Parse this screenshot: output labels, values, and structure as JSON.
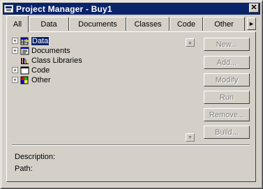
{
  "window": {
    "title": "Project Manager - Buy1",
    "close_glyph": "✕"
  },
  "tabs": [
    {
      "label": "All",
      "active": true
    },
    {
      "label": "Data",
      "active": false
    },
    {
      "label": "Documents",
      "active": false
    },
    {
      "label": "Classes",
      "active": false
    },
    {
      "label": "Code",
      "active": false
    },
    {
      "label": "Other",
      "active": false
    }
  ],
  "tab_scroll_glyph": "►",
  "tree": {
    "items": [
      {
        "label": "Data",
        "expander": "+",
        "icon": "database-icon",
        "selected": true
      },
      {
        "label": "Documents",
        "expander": "+",
        "icon": "documents-icon",
        "selected": false
      },
      {
        "label": "Class Libraries",
        "expander": "",
        "icon": "class-libraries-icon",
        "selected": false
      },
      {
        "label": "Code",
        "expander": "+",
        "icon": "code-window-icon",
        "selected": false
      },
      {
        "label": "Other",
        "expander": "+",
        "icon": "other-icon",
        "selected": false
      }
    ]
  },
  "scrollbar": {
    "up": "▲",
    "down": "▼"
  },
  "buttons": {
    "new": "New...",
    "add": "Add...",
    "modify": "Modify",
    "run": "Run",
    "remove": "Remove...",
    "build": "Build..."
  },
  "info": {
    "description_label": "Description:",
    "path_label": "Path:"
  }
}
